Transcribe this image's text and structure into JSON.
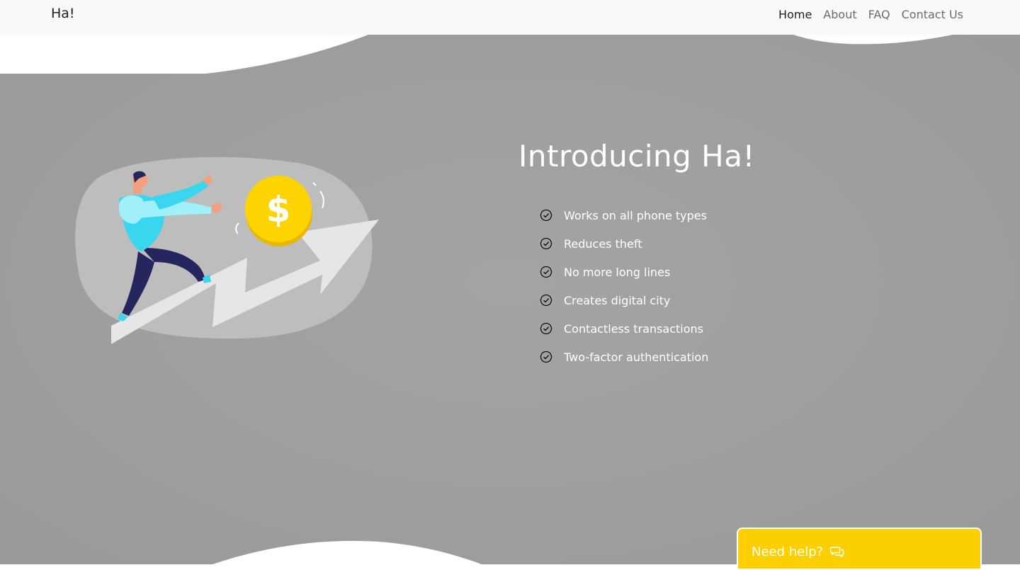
{
  "navbar": {
    "brand": "Ha!",
    "links": [
      {
        "label": "Home",
        "active": true
      },
      {
        "label": "About",
        "active": false
      },
      {
        "label": "FAQ",
        "active": false
      },
      {
        "label": "Contact Us",
        "active": false
      }
    ]
  },
  "hero": {
    "title": "Introducing Ha!",
    "features": [
      "Works on all phone types",
      "Reduces theft",
      "No more long lines",
      "Creates digital city",
      "Contactless transactions",
      "Two-factor authentication"
    ],
    "illustration_icon": "person-chasing-coin-icon"
  },
  "help_widget": {
    "label": "Need help?",
    "icon": "chat-bubbles-icon"
  },
  "colors": {
    "hero_background": "#a0a0a0",
    "navbar_background": "#f8f9fb",
    "help_button": "#fccf00",
    "coin": "#fdd400"
  }
}
